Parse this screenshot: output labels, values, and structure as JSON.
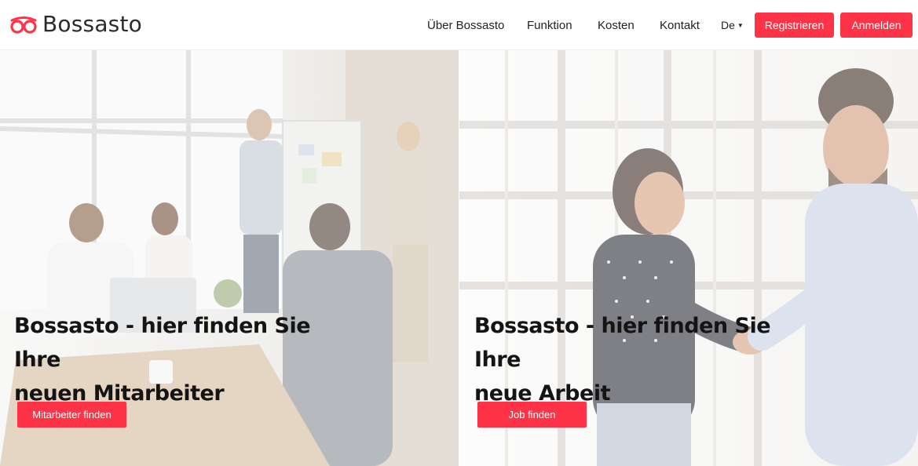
{
  "brand": {
    "name": "Bossasto",
    "accent": "#ff3347"
  },
  "nav": {
    "links": [
      "Über Bossasto",
      "Funktion",
      "Kosten",
      "Kontakt"
    ],
    "language": "De",
    "register_label": "Registrieren",
    "login_label": "Anmelden"
  },
  "hero": {
    "left": {
      "headline_line1": "Bossasto - hier finden Sie Ihre",
      "headline_line2": "neuen Mitarbeiter",
      "button_label": "Mitarbeiter finden"
    },
    "right": {
      "headline_line1": "Bossasto - hier finden Sie Ihre",
      "headline_line2": "neue Arbeit",
      "button_label": "Job finden"
    }
  },
  "icons": [
    "bossasto-logo-icon",
    "caret-down-icon"
  ]
}
